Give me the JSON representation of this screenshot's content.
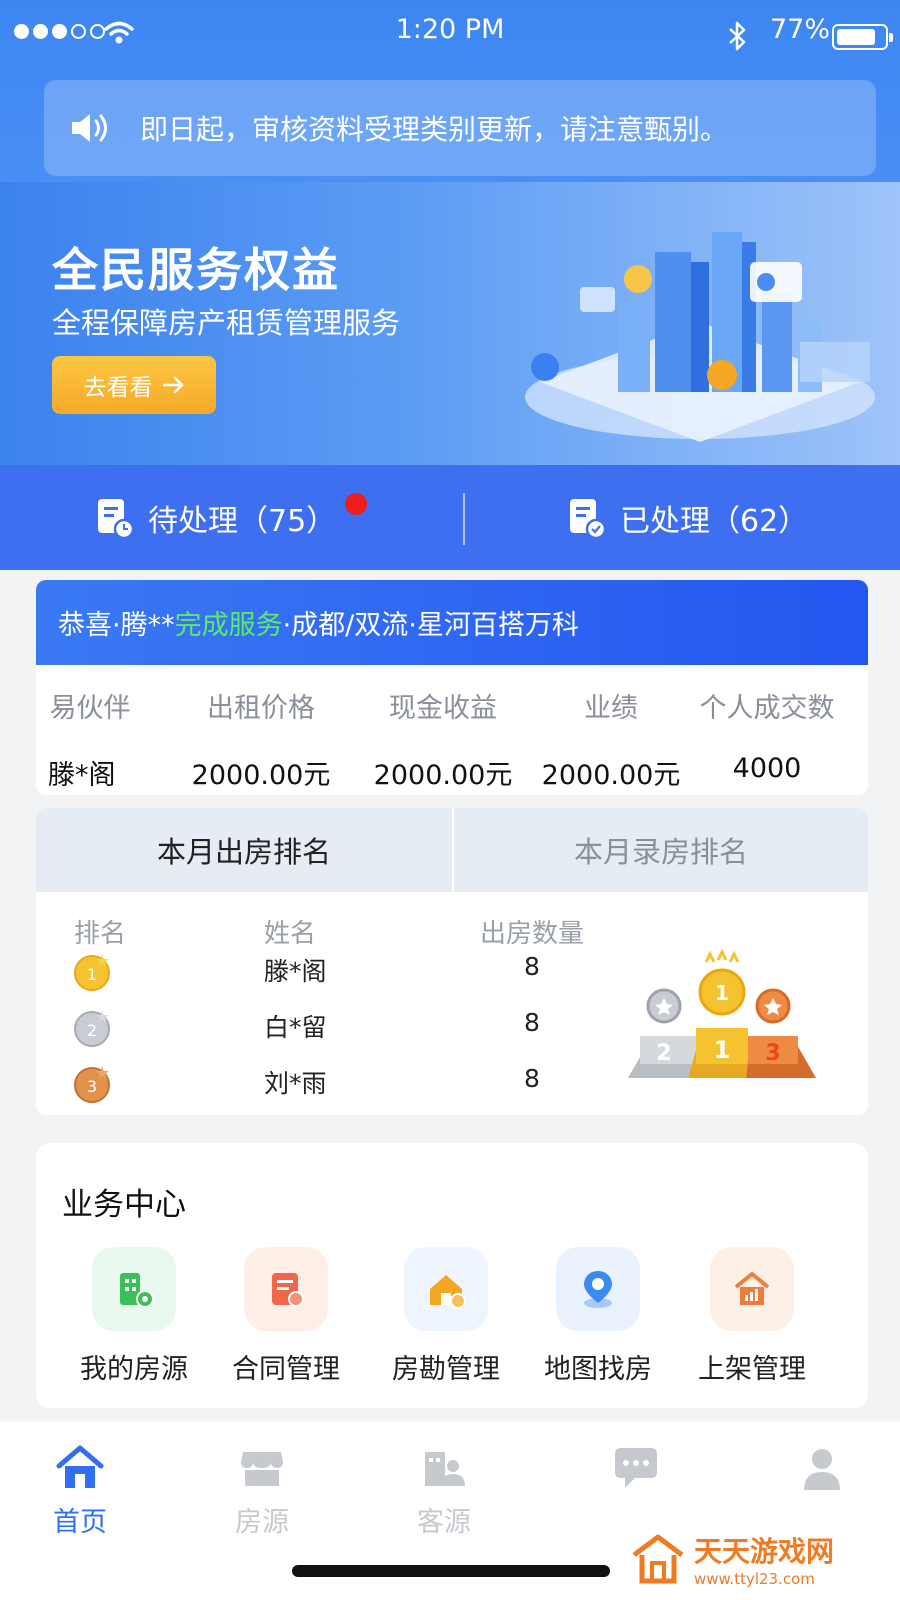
{
  "status_bar": {
    "time": "1:20 PM",
    "battery": "77%"
  },
  "notice": {
    "text": "即日起，审核资料受理类别更新，请注意甄别。"
  },
  "banner": {
    "title": "全民服务权益",
    "subtitle": "全程保障房产租赁管理服务",
    "button_label": "去看看"
  },
  "tabs": {
    "pending_label": "待处理（75）",
    "done_label": "已处理（62）"
  },
  "congrats": {
    "prefix": "恭喜·腾** ",
    "highlight": "完成服务",
    "suffix": "·成都/双流·星河百搭万科"
  },
  "stats": {
    "headers": [
      "易伙伴",
      "出租价格",
      "现金收益",
      "业绩",
      "个人成交数"
    ],
    "values": [
      "滕*阁",
      "2000.00元",
      "2000.00元",
      "2000.00元",
      "4000"
    ]
  },
  "ranking": {
    "tab_active": "本月出房排名",
    "tab_inactive": "本月录房排名",
    "headers": [
      "排名",
      "姓名",
      "出房数量"
    ],
    "rows": [
      {
        "name": "滕*阁",
        "count": "8",
        "medal_number": "1"
      },
      {
        "name": "白*留",
        "count": "8",
        "medal_number": "2"
      },
      {
        "name": "刘*雨",
        "count": "8",
        "medal_number": "3"
      }
    ],
    "podium_numbers": [
      "2",
      "1",
      "3"
    ]
  },
  "business": {
    "title": "业务中心",
    "items": [
      {
        "label": "我的房源",
        "icon": "building-icon",
        "color": "#3bbf5a"
      },
      {
        "label": "合同管理",
        "icon": "contract-icon",
        "color": "#f0664a"
      },
      {
        "label": "房勘管理",
        "icon": "house-inspect-icon",
        "color": "#f5a623"
      },
      {
        "label": "地图找房",
        "icon": "map-pin-icon",
        "color": "#3b8af0"
      },
      {
        "label": "上架管理",
        "icon": "shelf-house-icon",
        "color": "#f07b3a"
      }
    ]
  },
  "bottom_nav": {
    "items": [
      {
        "label": "首页",
        "icon": "home-icon",
        "active": true
      },
      {
        "label": "房源",
        "icon": "store-icon",
        "active": false
      },
      {
        "label": "客源",
        "icon": "customer-icon",
        "active": false
      },
      {
        "label": "",
        "icon": "message-icon",
        "active": false
      },
      {
        "label": "",
        "icon": "profile-icon",
        "active": false
      }
    ]
  },
  "watermark": {
    "name": "天天游戏网",
    "url": "www.ttyl23.com"
  },
  "colors": {
    "primary": "#3d6ff0",
    "accent_yellow": "#f7b531",
    "highlight_green": "#5ee86a",
    "badge_red": "#ee1c1c"
  }
}
